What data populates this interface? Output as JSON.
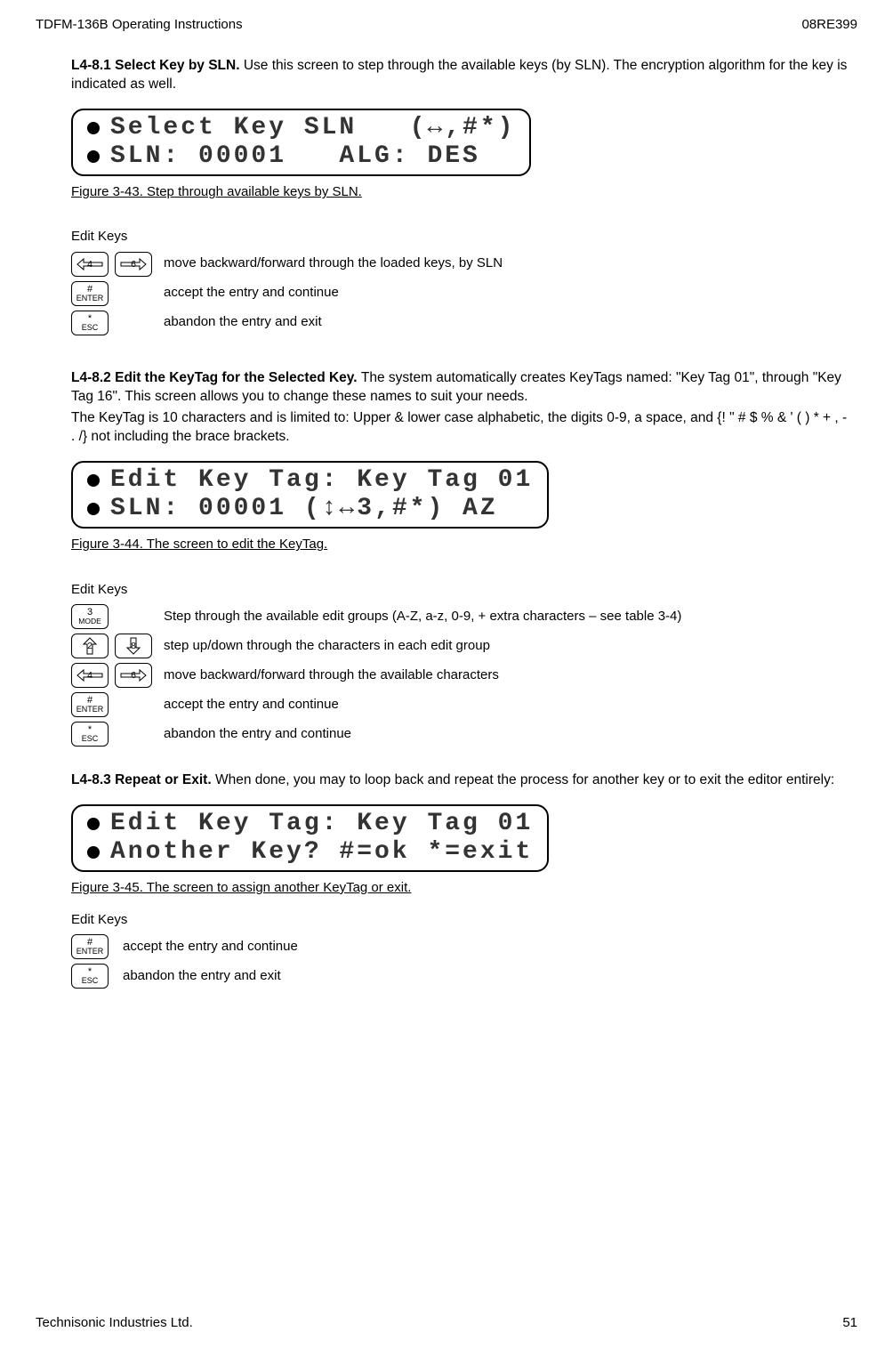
{
  "header": {
    "left": "TDFM-136B Operating Instructions",
    "right": "08RE399"
  },
  "s1": {
    "title": "L4-8.1 Select Key by SLN. ",
    "text": "Use this screen to step through the available keys (by SLN). The encryption algorithm for the key is indicated as well.",
    "lcd1": "Select Key SLN   (↔,#*)",
    "lcd2": "SLN: 00001   ALG: DES",
    "caption": "Figure 3-43. Step through available keys by SLN."
  },
  "editkeys_label": "Edit Keys",
  "k1": {
    "r1": "move backward/forward through the loaded keys, by SLN",
    "r2": "accept the entry and continue",
    "r3": "abandon the entry and exit"
  },
  "s2": {
    "title": "L4-8.2 Edit the KeyTag for the Selected Key. ",
    "text1": "The system automatically creates KeyTags named: \"Key Tag 01\", through \"Key Tag 16\".  This screen allows you to change these names to suit your needs.",
    "text2": "The KeyTag is 10 characters and is limited to:  Upper & lower case alphabetic, the digits 0-9, a space, and {! \" # $ % & ' ( ) * + , - . /}  not including the brace brackets.",
    "lcd1": "Edit Key Tag: Key Tag 01",
    "lcd2": "SLN: 00001 (↕↔3,#*) AZ",
    "caption": "Figure 3-44. The screen to edit the KeyTag."
  },
  "k2": {
    "r1": "Step through the available edit groups (A-Z, a-z, 0-9, + extra characters – see table 3-4)",
    "r2": "step up/down through the characters in each edit group",
    "r3": "move backward/forward through the available characters",
    "r4": "accept the entry and continue",
    "r5": "abandon the entry and continue"
  },
  "s3": {
    "title": "L4-8.3 Repeat or Exit. ",
    "text": "When done, you may to loop back and repeat the process for another key or to exit the editor entirely:",
    "lcd1": "Edit Key Tag: Key Tag 01",
    "lcd2": "Another Key? #=ok *=exit",
    "caption": "Figure 3-45. The screen to assign another KeyTag or exit."
  },
  "k3": {
    "r1": "accept the entry and continue",
    "r2": "abandon the entry and exit"
  },
  "btn": {
    "n2": "2",
    "n3": "3",
    "n4": "4",
    "n6": "6",
    "n8": "8",
    "hash": "#",
    "enter": "ENTER",
    "star": "*",
    "esc": "ESC",
    "mode": "MODE"
  },
  "footer": {
    "left": "Technisonic Industries Ltd.",
    "right": "51"
  }
}
